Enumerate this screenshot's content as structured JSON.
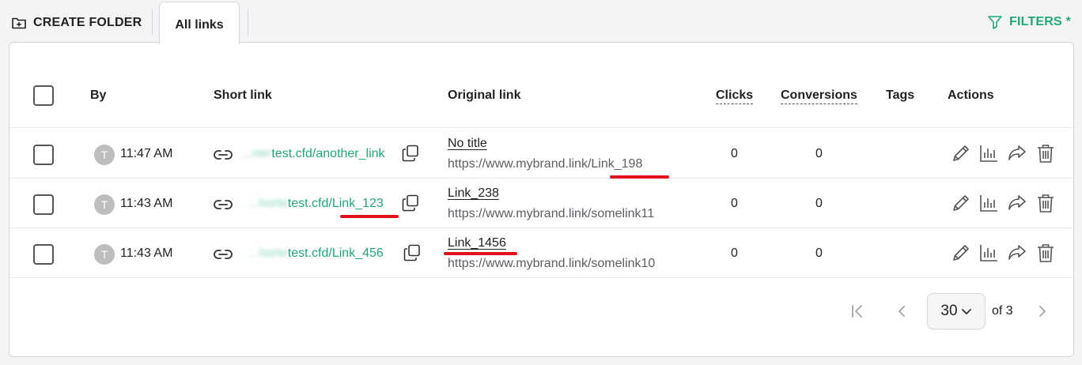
{
  "toolbar": {
    "create_folder_label": "CREATE FOLDER",
    "tab_all_links": "All links",
    "filters_label": "FILTERS *"
  },
  "table": {
    "columns": {
      "by": "By",
      "short_link": "Short link",
      "original_link": "Original link",
      "clicks": "Clicks",
      "conversions": "Conversions",
      "tags": "Tags",
      "actions": "Actions"
    },
    "rows": [
      {
        "time": "11:47 AM",
        "avatar": "T",
        "short_blur": "...rter",
        "short_visible": "test.cfd/another_link",
        "title": "No title",
        "url": "https://www.mybrand.link/Link_198",
        "clicks": "0",
        "conversions": "0"
      },
      {
        "time": "11:43 AM",
        "avatar": "T",
        "short_blur": "...horte",
        "short_visible": "test.cfd/Link_123",
        "title": "Link_238",
        "url": "https://www.mybrand.link/somelink11",
        "clicks": "0",
        "conversions": "0"
      },
      {
        "time": "11:43 AM",
        "avatar": "T",
        "short_blur": "...horte",
        "short_visible": "test.cfd/Link_456",
        "title": "Link_1456",
        "url": "https://www.mybrand.link/somelink10",
        "clicks": "0",
        "conversions": "0"
      }
    ]
  },
  "pagination": {
    "per_page": "30",
    "of_label": "of 3"
  },
  "colors": {
    "accent_green": "#22a874",
    "highlight_red": "#e0121a"
  },
  "icons": [
    "folder-plus-icon",
    "filter-icon",
    "link-icon",
    "copy-icon",
    "edit-icon",
    "stats-icon",
    "share-icon",
    "trash-icon",
    "first-page-icon",
    "prev-page-icon",
    "next-page-icon",
    "chevron-down-icon"
  ]
}
